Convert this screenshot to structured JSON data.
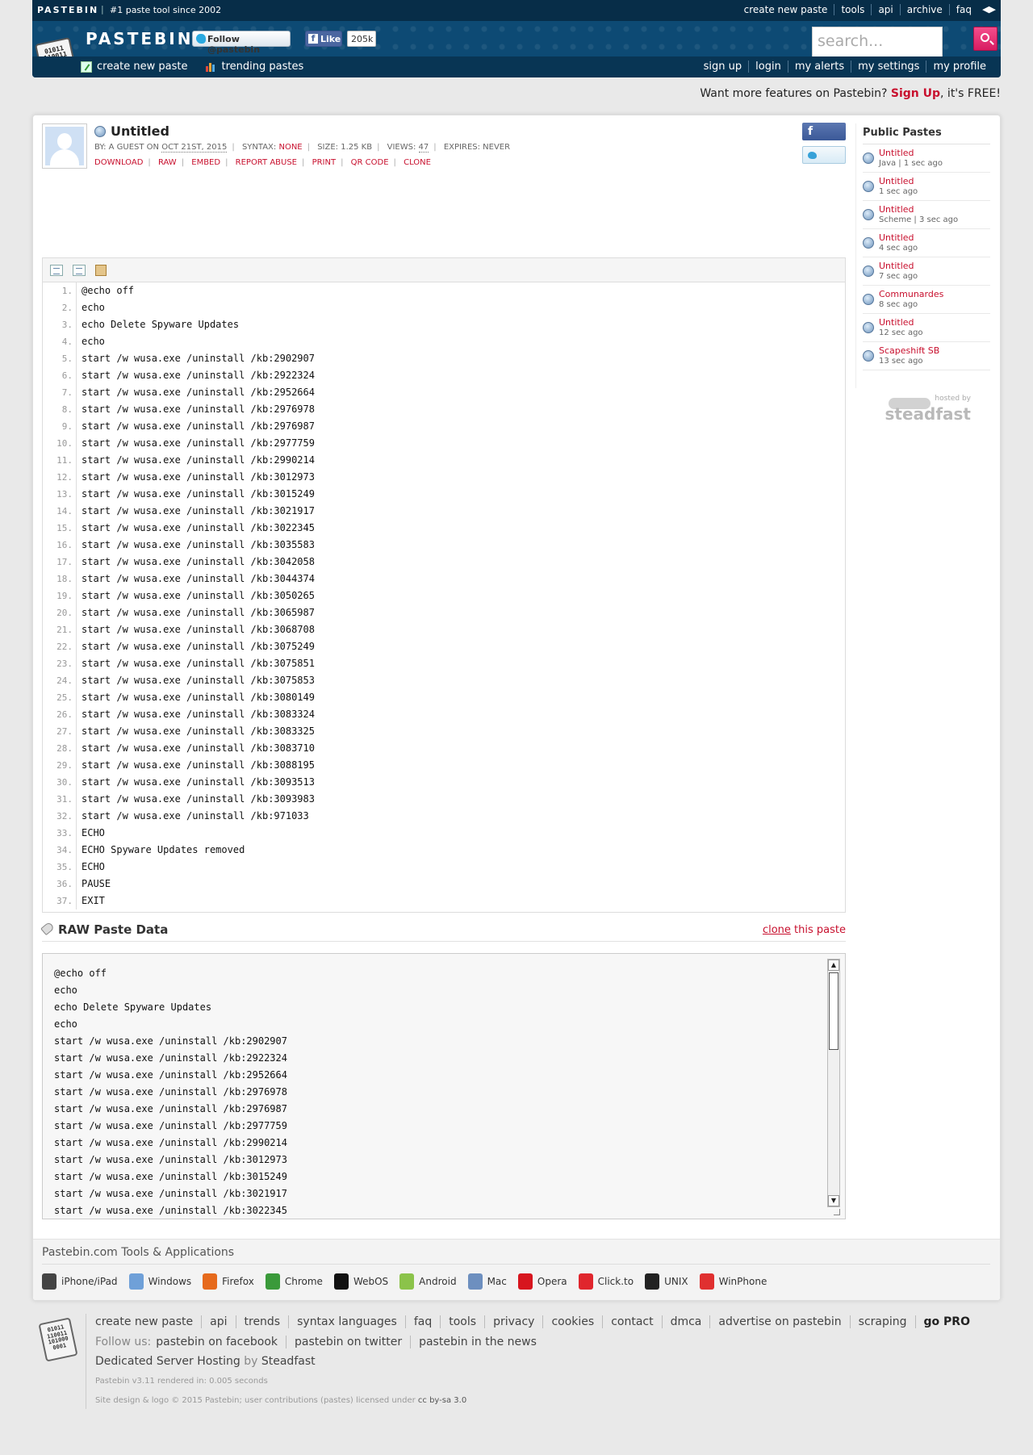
{
  "header": {
    "brand_small": "PASTEBIN",
    "tagline": "#1 paste tool since 2002",
    "top_links": [
      "create new paste",
      "tools",
      "api",
      "archive",
      "faq"
    ],
    "logo_text": "PASTEBIN",
    "logo_bits": [
      "01011",
      "110011",
      "101000",
      "0001"
    ],
    "follow_label": "Follow @pastebin",
    "like_label": "Like",
    "like_count": "205k",
    "search_placeholder": "search...",
    "sub_left": [
      "create new paste",
      "trending pastes"
    ],
    "sub_right": [
      "sign up",
      "login",
      "my alerts",
      "my settings",
      "my profile"
    ]
  },
  "promo": {
    "prefix": "Want more features on Pastebin? ",
    "signup": "Sign Up",
    "suffix": ", it's FREE!"
  },
  "paste": {
    "title": "Untitled",
    "by_label": "BY: A GUEST ON",
    "date": "OCT 21ST, 2015",
    "syntax_label": "SYNTAX:",
    "syntax": "NONE",
    "size_label": "SIZE: 1.25 KB",
    "views_label": "VIEWS:",
    "views": "47",
    "expires_label": "EXPIRES: NEVER",
    "actions": [
      "DOWNLOAD",
      "RAW",
      "EMBED",
      "REPORT ABUSE",
      "PRINT",
      "QR CODE",
      "CLONE"
    ],
    "share_fb": "f",
    "lines": [
      "@echo off",
      "echo",
      "echo Delete Spyware Updates",
      "echo",
      "start /w wusa.exe /uninstall /kb:2902907",
      "start /w wusa.exe /uninstall /kb:2922324",
      "start /w wusa.exe /uninstall /kb:2952664",
      "start /w wusa.exe /uninstall /kb:2976978",
      "start /w wusa.exe /uninstall /kb:2976987",
      "start /w wusa.exe /uninstall /kb:2977759",
      "start /w wusa.exe /uninstall /kb:2990214",
      "start /w wusa.exe /uninstall /kb:3012973",
      "start /w wusa.exe /uninstall /kb:3015249",
      "start /w wusa.exe /uninstall /kb:3021917",
      "start /w wusa.exe /uninstall /kb:3022345",
      "start /w wusa.exe /uninstall /kb:3035583",
      "start /w wusa.exe /uninstall /kb:3042058",
      "start /w wusa.exe /uninstall /kb:3044374",
      "start /w wusa.exe /uninstall /kb:3050265",
      "start /w wusa.exe /uninstall /kb:3065987",
      "start /w wusa.exe /uninstall /kb:3068708",
      "start /w wusa.exe /uninstall /kb:3075249",
      "start /w wusa.exe /uninstall /kb:3075851",
      "start /w wusa.exe /uninstall /kb:3075853",
      "start /w wusa.exe /uninstall /kb:3080149",
      "start /w wusa.exe /uninstall /kb:3083324",
      "start /w wusa.exe /uninstall /kb:3083325",
      "start /w wusa.exe /uninstall /kb:3083710",
      "start /w wusa.exe /uninstall /kb:3088195",
      "start /w wusa.exe /uninstall /kb:3093513",
      "start /w wusa.exe /uninstall /kb:3093983",
      "start /w wusa.exe /uninstall /kb:971033",
      "ECHO",
      "ECHO Spyware Updates removed",
      "ECHO",
      "PAUSE",
      "EXIT"
    ]
  },
  "raw": {
    "title": "RAW Paste Data",
    "clone_link": "clone",
    "clone_suffix": " this paste",
    "visible_line_count": 15
  },
  "sidebar": {
    "title": "Public Pastes",
    "items": [
      {
        "name": "Untitled",
        "sub": "Java | 1 sec ago"
      },
      {
        "name": "Untitled",
        "sub": "1 sec ago"
      },
      {
        "name": "Untitled",
        "sub": "Scheme | 3 sec ago"
      },
      {
        "name": "Untitled",
        "sub": "4 sec ago"
      },
      {
        "name": "Untitled",
        "sub": "7 sec ago"
      },
      {
        "name": "Communardes",
        "sub": "8 sec ago"
      },
      {
        "name": "Untitled",
        "sub": "12 sec ago"
      },
      {
        "name": "Scapeshift SB",
        "sub": "13 sec ago"
      }
    ],
    "hosted_by": "hosted by",
    "steadfast": "steadfast"
  },
  "tools": {
    "title": "Pastebin.com Tools & Applications",
    "items": [
      {
        "label": "iPhone/iPad",
        "color": "#444444"
      },
      {
        "label": "Windows",
        "color": "#6fa0d8"
      },
      {
        "label": "Firefox",
        "color": "#e66a1c"
      },
      {
        "label": "Chrome",
        "color": "#3a9a3a"
      },
      {
        "label": "WebOS",
        "color": "#111111"
      },
      {
        "label": "Android",
        "color": "#8bc34a"
      },
      {
        "label": "Mac",
        "color": "#6d8fbf"
      },
      {
        "label": "Opera",
        "color": "#d7151e"
      },
      {
        "label": "Click.to",
        "color": "#e0262d"
      },
      {
        "label": "UNIX",
        "color": "#222222"
      },
      {
        "label": "WinPhone",
        "color": "#e03030"
      }
    ]
  },
  "footer": {
    "links": [
      "create new paste",
      "api",
      "trends",
      "syntax languages",
      "faq",
      "tools",
      "privacy",
      "cookies",
      "contact",
      "dmca",
      "advertise on pastebin",
      "scraping",
      "go PRO"
    ],
    "follow_label": "Follow us:",
    "follow_links": [
      "pastebin on facebook",
      "pastebin on twitter",
      "pastebin in the news"
    ],
    "hosting": "Dedicated Server Hosting",
    "hosting_by": " by ",
    "hosting_company": "Steadfast",
    "rendered": "Pastebin v3.11 rendered in: 0.005 seconds",
    "copyright": "Site design & logo © 2015 Pastebin; user contributions (pastes) licensed under ",
    "license": "cc by-sa 3.0"
  }
}
